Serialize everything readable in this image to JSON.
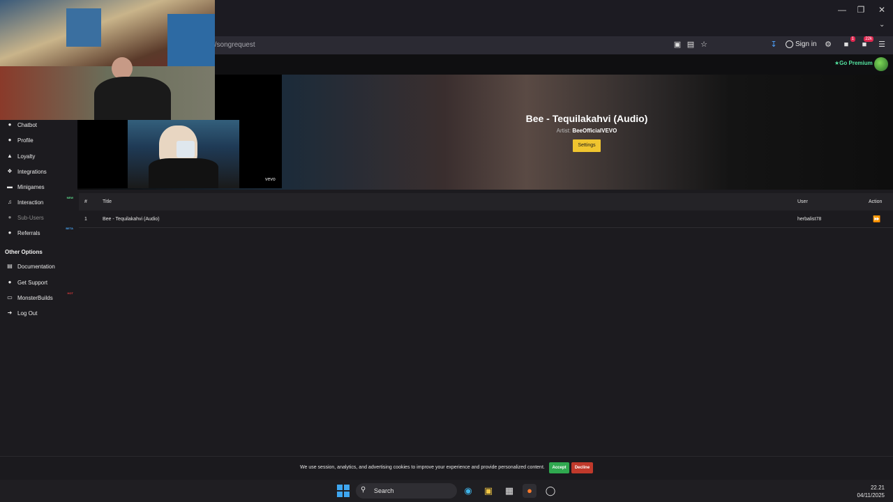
{
  "browser": {
    "url": "el/songrequest",
    "sign_in_label": "Sign in",
    "notif_count_1": "1",
    "notif_count_2": "22k"
  },
  "header": {
    "go_premium_label": "Go Premium"
  },
  "sidebar": {
    "items": [
      {
        "label": "Chatbot",
        "icon": "chatbot-icon"
      },
      {
        "label": "Profile",
        "icon": "profile-icon"
      },
      {
        "label": "Loyalty",
        "icon": "trophy-icon"
      },
      {
        "label": "Integrations",
        "icon": "integrations-icon"
      },
      {
        "label": "Minigames",
        "icon": "gamepad-icon"
      },
      {
        "label": "Interaction",
        "icon": "music-icon",
        "tag": "NEW"
      },
      {
        "label": "Sub-Users",
        "icon": "users-icon"
      },
      {
        "label": "Referrals",
        "icon": "referrals-icon",
        "tag": "BETA"
      }
    ],
    "other_options_heading": "Other Options",
    "other_items": [
      {
        "label": "Documentation",
        "icon": "book-icon"
      },
      {
        "label": "Get Support",
        "icon": "support-icon"
      },
      {
        "label": "MonsterBuilds",
        "icon": "laptop-icon",
        "tag": "HOT"
      },
      {
        "label": "Log Out",
        "icon": "logout-icon"
      }
    ]
  },
  "player": {
    "song_title": "Bee - Tequilakahvi (Audio)",
    "artist_label": "Artist:",
    "artist_name": "BeeOfficialVEVO",
    "settings_label": "Settings",
    "watermark": "vevo"
  },
  "queue": {
    "columns": [
      "#",
      "Title",
      "User",
      "Action"
    ],
    "rows": [
      {
        "index": "1",
        "title": "Bee - Tequilakahvi (Audio)",
        "user": "herbalist78"
      }
    ]
  },
  "cookie": {
    "text": "We use session, analytics, and advertising cookies to improve your experience and provide personalized content.",
    "accept_label": "Accept",
    "decline_label": "Decline"
  },
  "taskbar": {
    "search_label": "Search",
    "time": "22.21",
    "date": "04/11/2025"
  },
  "colors": {
    "accent_green": "#54e3a0",
    "settings_yellow": "#f0c52f",
    "accept_green": "#2fa84f",
    "decline_red": "#c0392b",
    "tag_new": "#5fe08f",
    "tag_beta": "#49a3f0",
    "tag_hot": "#e03a3a"
  }
}
